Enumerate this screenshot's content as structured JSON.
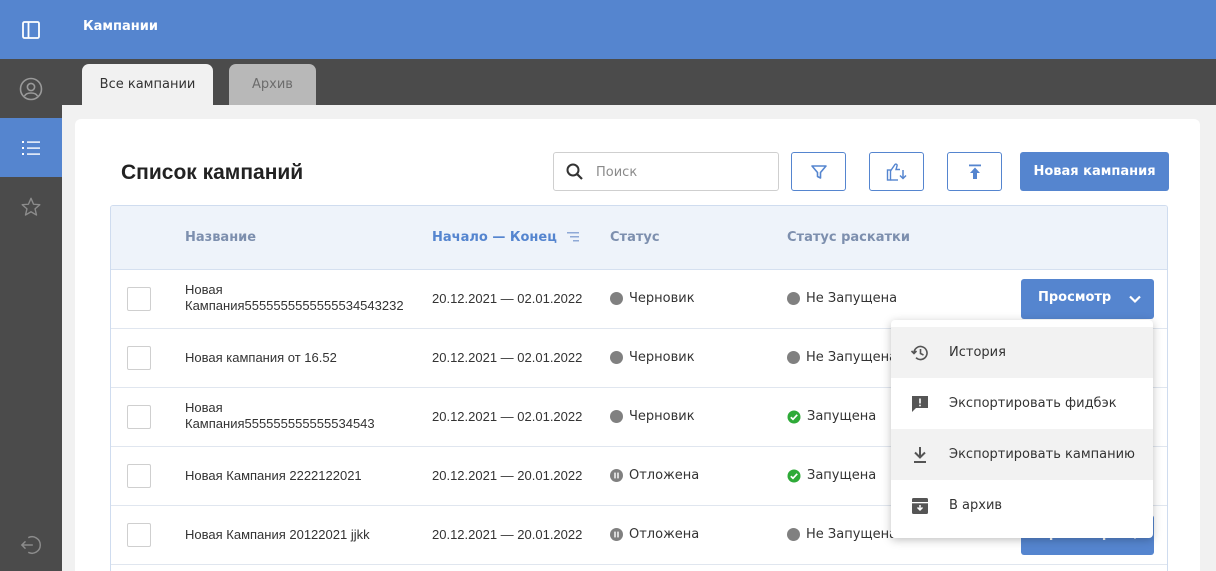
{
  "app": {
    "title": "Кампании"
  },
  "sidebar": {
    "items": [
      {
        "icon": "panel-toggle-icon"
      },
      {
        "icon": "user-circle-icon"
      },
      {
        "icon": "list-icon",
        "active": true
      },
      {
        "icon": "star-icon"
      }
    ],
    "logout_icon": "logout-icon"
  },
  "tabs": [
    {
      "label": "Все кампании",
      "active": true
    },
    {
      "label": "Архив",
      "active": false
    }
  ],
  "main": {
    "title": "Список кампаний",
    "search": {
      "placeholder": "Поиск",
      "value": ""
    },
    "new_button": "Новая кампания"
  },
  "table": {
    "columns": [
      "Название",
      "Начало — Конец",
      "Статус",
      "Статус раскатки"
    ],
    "rows": [
      {
        "name_line1": "Новая",
        "name_line2": "Кампания5555555555555534543232",
        "dates": "20.12.2021 — 02.01.2022",
        "status": "Черновик",
        "rollout": "Не Запущена",
        "action": "Просмотр"
      },
      {
        "name_line1": "Новая кампания от 16.52",
        "name_line2": "",
        "dates": "20.12.2021 — 02.01.2022",
        "status": "Черновик",
        "rollout": "Не Запущена"
      },
      {
        "name_line1": "Новая",
        "name_line2": "Кампания555555555555534543",
        "dates": "20.12.2021 — 02.01.2022",
        "status": "Черновик",
        "rollout": "Запущена"
      },
      {
        "name_line1": "Новая Кампания 2222122021",
        "name_line2": "",
        "dates": "20.12.2021 — 20.01.2022",
        "status": "Отложена",
        "rollout": "Запущена"
      },
      {
        "name_line1": "Новая Кампания 20122021 jjkk",
        "name_line2": "",
        "dates": "20.12.2021 — 20.01.2022",
        "status": "Отложена",
        "rollout": "Не Запущена",
        "action": "Просмотр"
      }
    ]
  },
  "dropdown": {
    "items": [
      {
        "label": "История",
        "icon": "history-icon"
      },
      {
        "label": "Экспортировать фидбэк",
        "icon": "feedback-icon"
      },
      {
        "label": "Экспортировать кампанию",
        "icon": "download-icon"
      },
      {
        "label": "В архив",
        "icon": "archive-icon"
      }
    ]
  },
  "colors": {
    "accent": "#5585cf",
    "sidebar": "#4b4b4b",
    "draft": "#808080",
    "running": "#2eaa38"
  }
}
